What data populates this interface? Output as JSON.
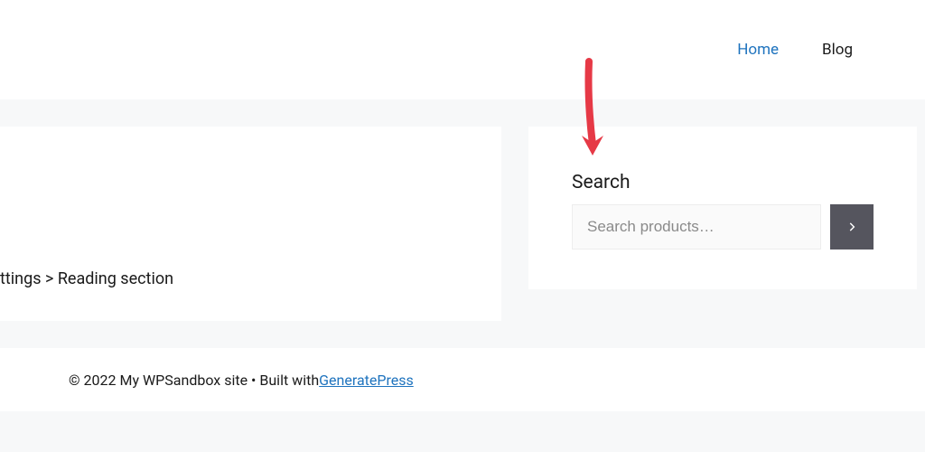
{
  "nav": {
    "home": "Home",
    "blog": "Blog"
  },
  "main": {
    "reading_text": "ttings > Reading section"
  },
  "sidebar": {
    "search_heading": "Search",
    "search_placeholder": "Search products…"
  },
  "footer": {
    "copyright": "© 2022 My WPSandbox site • Built with ",
    "link_text": "GeneratePress"
  },
  "annotation": {
    "arrow_color": "#e63946"
  }
}
